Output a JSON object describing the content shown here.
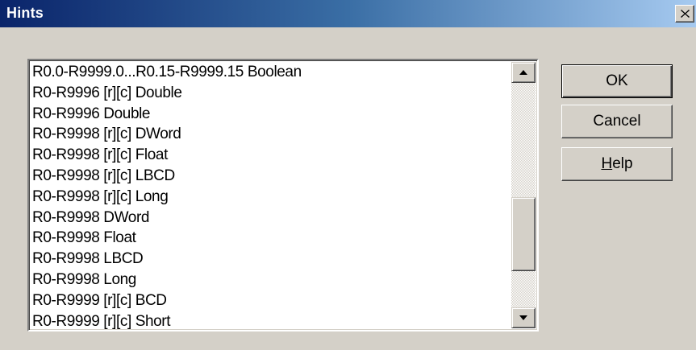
{
  "window": {
    "title": "Hints"
  },
  "list": {
    "items": [
      "R0.0-R9999.0...R0.15-R9999.15 Boolean",
      "R0-R9996 [r][c] Double",
      "R0-R9996 Double",
      "R0-R9998 [r][c] DWord",
      "R0-R9998 [r][c] Float",
      "R0-R9998 [r][c] LBCD",
      "R0-R9998 [r][c] Long",
      "R0-R9998 DWord",
      "R0-R9998 Float",
      "R0-R9998 LBCD",
      "R0-R9998 Long",
      "R0-R9999 [r][c] BCD",
      "R0-R9999 [r][c] Short"
    ]
  },
  "buttons": {
    "ok": "OK",
    "cancel": "Cancel",
    "help_mnemonic": "H",
    "help_rest": "elp"
  },
  "icons": {
    "close": "close-icon",
    "scroll_up": "arrow-up-icon",
    "scroll_down": "arrow-down-icon"
  }
}
